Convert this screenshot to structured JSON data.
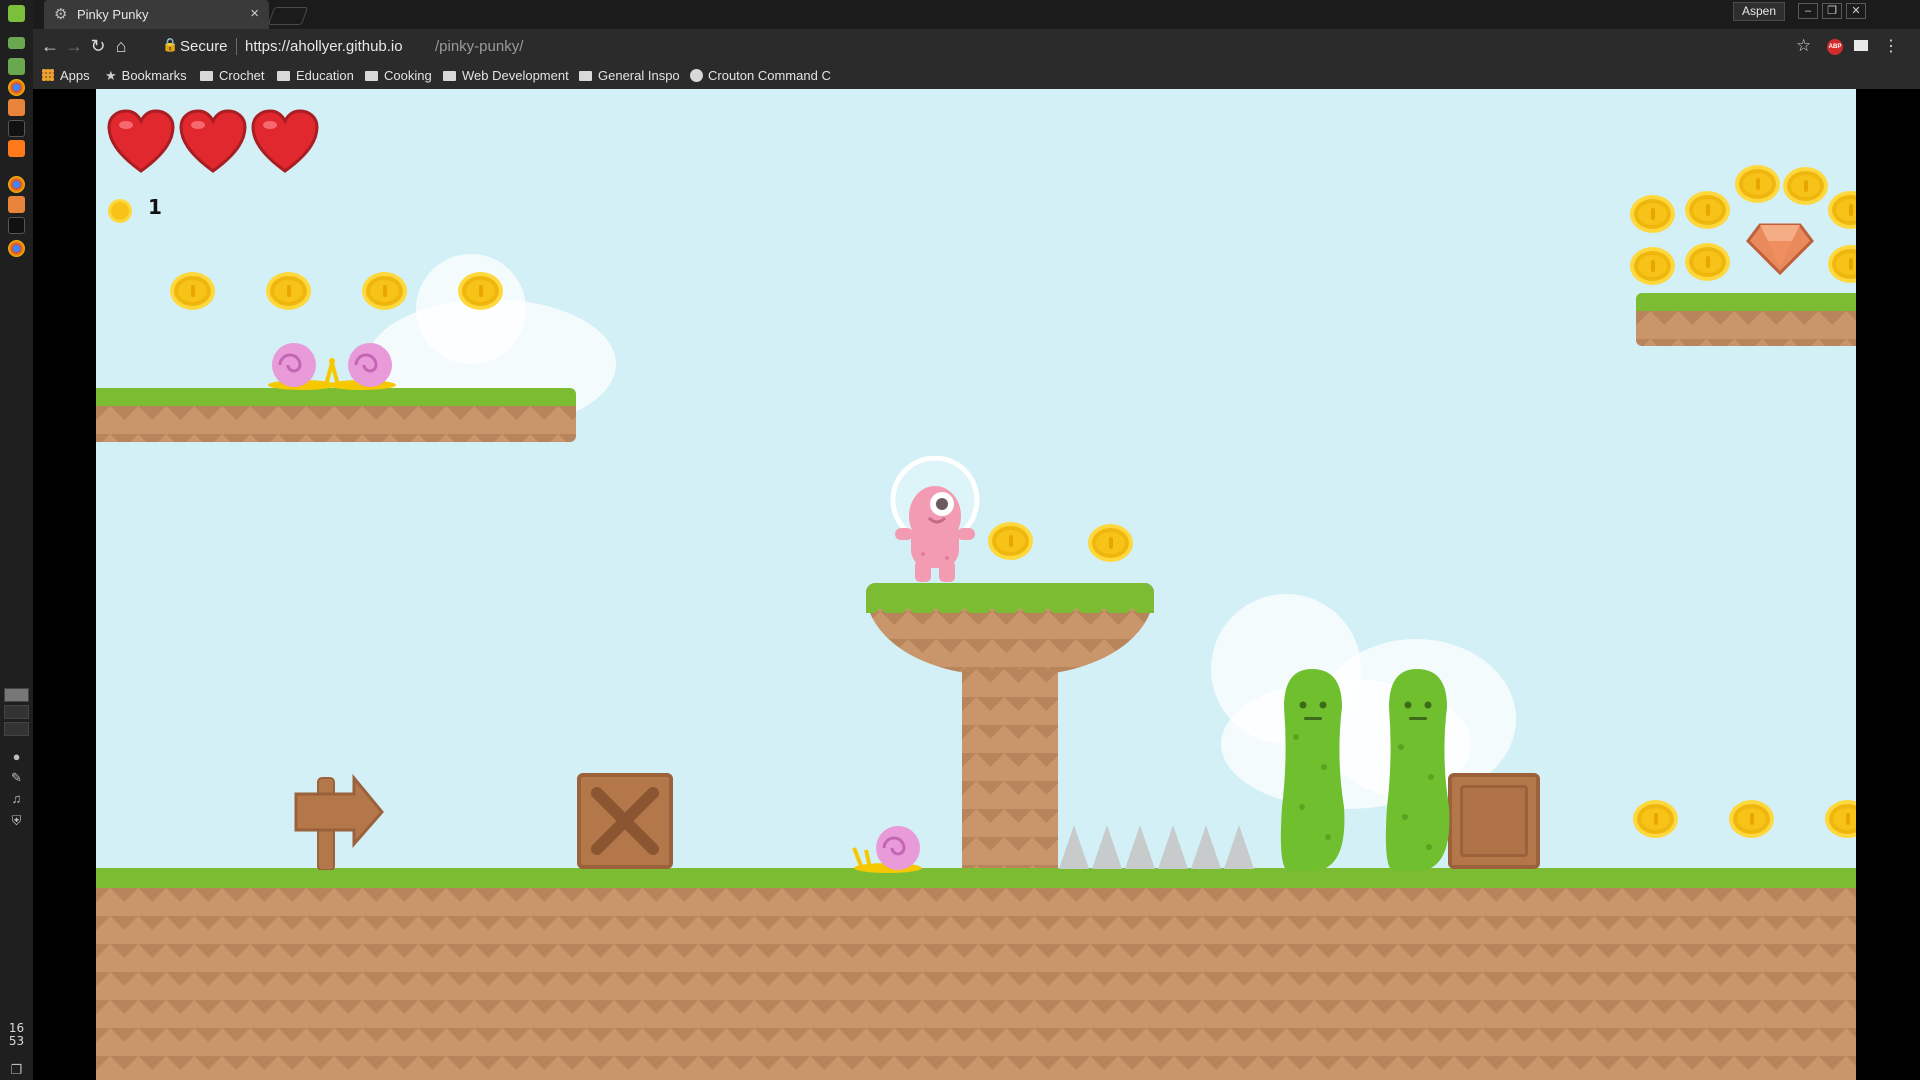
{
  "os": {
    "clock_hour": "16",
    "clock_minute": "53"
  },
  "browser": {
    "tab_title": "Pinky Punky",
    "profile_name": "Aspen",
    "security_label": "Secure",
    "url_host": "https://ahollyer.github.io",
    "url_path": "/pinky-punky/",
    "bookmarks": [
      "Apps",
      "Bookmarks",
      "Crochet",
      "Education",
      "Cooking",
      "Web Development",
      "General Inspo",
      "Crouton Command C"
    ]
  },
  "game": {
    "lives": 3,
    "coin_count": "1",
    "colors": {
      "sky": "#d2f0f6",
      "grass": "#7cbc32",
      "dirt": "#c9956a",
      "coin": "#f7c318",
      "heart": "#e0282e",
      "player": "#f49bb4",
      "slime": "#6fbf2e",
      "gem": "#e98a5c"
    }
  }
}
